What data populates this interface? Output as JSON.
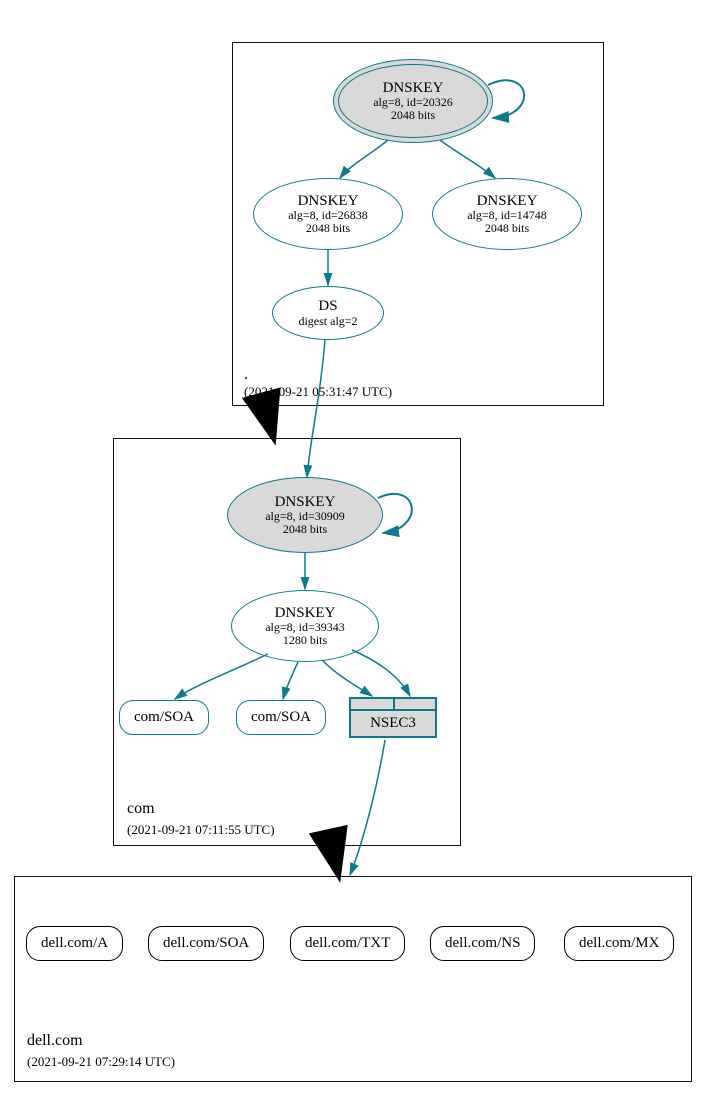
{
  "zones": {
    "root": {
      "label": ".",
      "timestamp": "(2021-09-21 05:31:47 UTC)"
    },
    "com": {
      "label": "com",
      "timestamp": "(2021-09-21 07:11:55 UTC)"
    },
    "dell": {
      "label": "dell.com",
      "timestamp": "(2021-09-21 07:29:14 UTC)"
    }
  },
  "nodes": {
    "root_ksk": {
      "title": "DNSKEY",
      "sub1": "alg=8, id=20326",
      "sub2": "2048 bits"
    },
    "root_zsk1": {
      "title": "DNSKEY",
      "sub1": "alg=8, id=26838",
      "sub2": "2048 bits"
    },
    "root_zsk2": {
      "title": "DNSKEY",
      "sub1": "alg=8, id=14748",
      "sub2": "2048 bits"
    },
    "root_ds": {
      "title": "DS",
      "sub1": "digest alg=2"
    },
    "com_ksk": {
      "title": "DNSKEY",
      "sub1": "alg=8, id=30909",
      "sub2": "2048 bits"
    },
    "com_zsk": {
      "title": "DNSKEY",
      "sub1": "alg=8, id=39343",
      "sub2": "1280 bits"
    },
    "com_soa1": {
      "label": "com/SOA"
    },
    "com_soa2": {
      "label": "com/SOA"
    },
    "nsec3": {
      "label": "NSEC3"
    },
    "dell_a": {
      "label": "dell.com/A"
    },
    "dell_soa": {
      "label": "dell.com/SOA"
    },
    "dell_txt": {
      "label": "dell.com/TXT"
    },
    "dell_ns": {
      "label": "dell.com/NS"
    },
    "dell_mx": {
      "label": "dell.com/MX"
    }
  },
  "colors": {
    "teal": "#0b7a8a",
    "grey": "#d9d9d9",
    "black": "#000000"
  }
}
